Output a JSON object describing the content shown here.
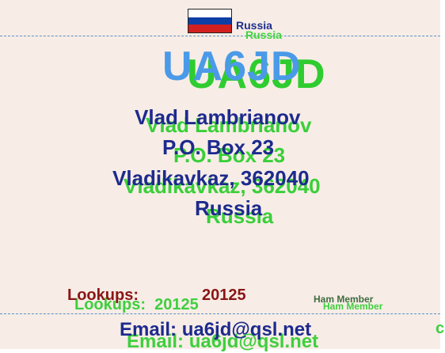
{
  "country_flag_icon": "russia-flag-icon",
  "country_label": "Russia",
  "callsign": "UA6JD",
  "address": {
    "name": "Vlad Lambrianov",
    "po_box": "P.O. Box 23",
    "city_zip": "Vladikavkaz, 362040",
    "country": "Russia"
  },
  "lookups": {
    "label": "Lookups:",
    "value": "20125"
  },
  "membership": "Ham Member",
  "email": "Email: ua6jd@qsl.net",
  "colors": {
    "background": "#f7ede6",
    "callsign_blue": "#4a9ae8",
    "shadow_green": "#39cf39",
    "text_navy": "#1d2a8e",
    "lookups_maroon": "#8a1616",
    "divider": "#5b8ec8"
  }
}
